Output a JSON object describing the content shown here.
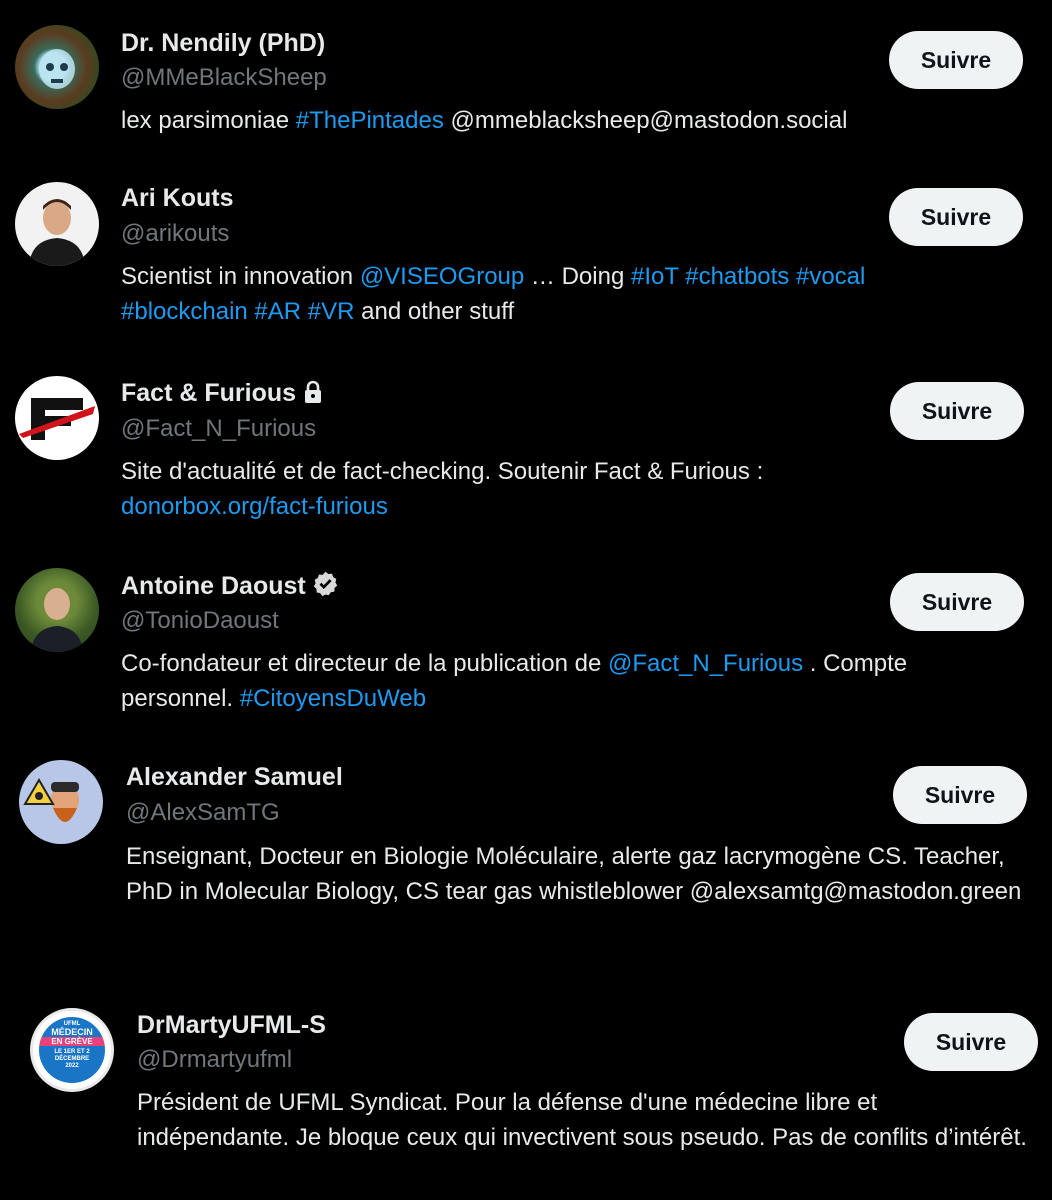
{
  "follow_label": "Suivre",
  "accounts": [
    {
      "name": "Dr. Nendily (PhD)",
      "handle": "@MMeBlackSheep",
      "bio": [
        {
          "t": "lex parsimoniae ",
          "link": false
        },
        {
          "t": "#ThePintades",
          "link": true
        },
        {
          "t": " @mmeblacksheep@mastodon.social",
          "link": false
        }
      ],
      "button": "Suivre"
    },
    {
      "name": "Ari Kouts",
      "handle": "@arikouts",
      "bio": [
        {
          "t": "Scientist in innovation ",
          "link": false
        },
        {
          "t": "@VISEOGroup",
          "link": true
        },
        {
          "t": " … Doing ",
          "link": false
        },
        {
          "t": "#IoT",
          "link": true
        },
        {
          "t": " ",
          "link": false
        },
        {
          "t": "#chatbots",
          "link": true
        },
        {
          "t": " ",
          "link": false
        },
        {
          "t": "#vocal",
          "link": true
        },
        {
          "t": " ",
          "link": false
        },
        {
          "t": "#blockchain",
          "link": true
        },
        {
          "t": " ",
          "link": false
        },
        {
          "t": "#AR",
          "link": true
        },
        {
          "t": " ",
          "link": false
        },
        {
          "t": "#VR",
          "link": true
        },
        {
          "t": " and other stuff",
          "link": false
        }
      ],
      "button": "Suivre"
    },
    {
      "name": "Fact & Furious",
      "handle": "@Fact_N_Furious",
      "badge": "lock-icon",
      "bio": [
        {
          "t": "Site d'actualité et de fact-checking. Soutenir Fact & Furious : ",
          "link": false
        },
        {
          "t": "donorbox.org/fact-furious",
          "link": true
        }
      ],
      "button": "Suivre"
    },
    {
      "name": "Antoine Daoust",
      "handle": "@TonioDaoust",
      "badge": "verified-icon",
      "bio": [
        {
          "t": "Co-fondateur et directeur de la publication de ",
          "link": false
        },
        {
          "t": "@Fact_N_Furious",
          "link": true
        },
        {
          "t": " . Compte personnel. ",
          "link": false
        },
        {
          "t": "#CitoyensDuWeb",
          "link": true
        }
      ],
      "button": "Suivre"
    },
    {
      "name": "Alexander Samuel",
      "handle": "@AlexSamTG",
      "bio": [
        {
          "t": "Enseignant, Docteur en Biologie Moléculaire, alerte gaz lacrymogène CS. Teacher, PhD in Molecular Biology, CS tear gas whistleblower @alexsamtg@mastodon.green",
          "link": false
        }
      ],
      "button": "Suivre"
    },
    {
      "name": "DrMartyUFML-S",
      "handle": "@Drmartyufml",
      "avatar_text": {
        "top": "UFML",
        "line1": "MÉDECIN",
        "line2": "EN GRÈVE",
        "line3": "LE 1ER ET 2",
        "line4": "DÉCEMBRE",
        "line5": "2022"
      },
      "bio": [
        {
          "t": "Président de UFML Syndicat. Pour la défense d'une médecine libre et indépendante. Je bloque ceux qui invectivent sous pseudo. Pas de conflits d’intérêt.",
          "link": false
        }
      ],
      "button": "Suivre"
    }
  ],
  "colors": {
    "background": "#000000",
    "text": "#e7e9ea",
    "secondary": "#71767b",
    "link": "#1d9bf0",
    "button_bg": "#eff3f4"
  }
}
